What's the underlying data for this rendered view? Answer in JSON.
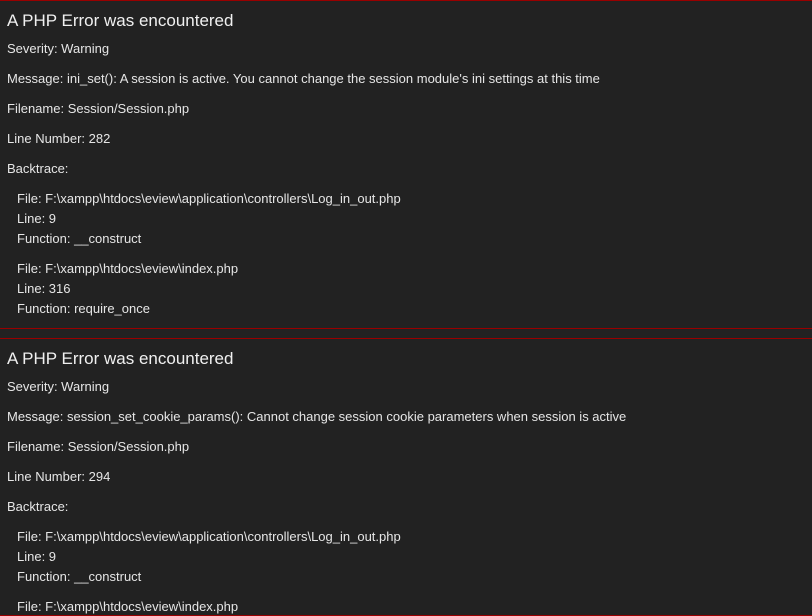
{
  "errors": [
    {
      "heading": "A PHP Error was encountered",
      "severity": "Severity: Warning",
      "message": "Message: ini_set(): A session is active. You cannot change the session module's ini settings at this time",
      "filename": "Filename: Session/Session.php",
      "line_number": "Line Number: 282",
      "backtrace_label": "Backtrace:",
      "backtrace": [
        {
          "file": "File: F:\\xampp\\htdocs\\eview\\application\\controllers\\Log_in_out.php",
          "line": "Line: 9",
          "function": "Function: __construct"
        },
        {
          "file": "File: F:\\xampp\\htdocs\\eview\\index.php",
          "line": "Line: 316",
          "function": "Function: require_once"
        }
      ]
    },
    {
      "heading": "A PHP Error was encountered",
      "severity": "Severity: Warning",
      "message": "Message: session_set_cookie_params(): Cannot change session cookie parameters when session is active",
      "filename": "Filename: Session/Session.php",
      "line_number": "Line Number: 294",
      "backtrace_label": "Backtrace:",
      "backtrace": [
        {
          "file": "File: F:\\xampp\\htdocs\\eview\\application\\controllers\\Log_in_out.php",
          "line": "Line: 9",
          "function": "Function: __construct"
        },
        {
          "file": "File: F:\\xampp\\htdocs\\eview\\index.php"
        }
      ]
    }
  ],
  "colors": {
    "background": "#222222",
    "text": "#e6e6e6",
    "border": "#990000"
  }
}
